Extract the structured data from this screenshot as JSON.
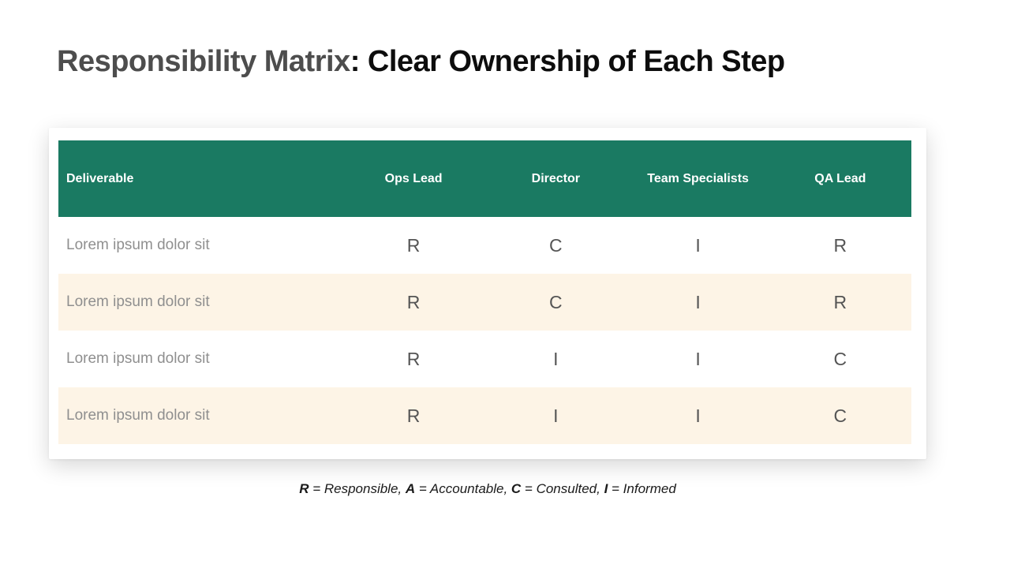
{
  "title": {
    "prefix": "Responsibility Matrix",
    "emphasis": ": Clear Ownership of Each Step"
  },
  "table": {
    "columns": [
      "Deliverable",
      "Ops Lead",
      "Director",
      "Team Specialists",
      "QA Lead"
    ],
    "rows": [
      {
        "deliverable": "Lorem ipsum dolor sit",
        "values": [
          "R",
          "C",
          "I",
          "R"
        ]
      },
      {
        "deliverable": "Lorem ipsum dolor sit",
        "values": [
          "R",
          "C",
          "I",
          "R"
        ]
      },
      {
        "deliverable": "Lorem ipsum dolor sit",
        "values": [
          "R",
          "I",
          "I",
          "C"
        ]
      },
      {
        "deliverable": "Lorem ipsum dolor sit",
        "values": [
          "R",
          "I",
          "I",
          "C"
        ]
      }
    ]
  },
  "legend": {
    "parts": [
      {
        "key": "R",
        "definition": " = Responsible, "
      },
      {
        "key": "A",
        "definition": " = Accountable, "
      },
      {
        "key": "C",
        "definition": " = Consulted, "
      },
      {
        "key": "I",
        "definition": " = Informed"
      }
    ]
  },
  "colors": {
    "header_bg": "#1a7a62",
    "header_text": "#ffffff",
    "row_bg": "#ffffff",
    "row_alt_bg": "#fdf4e6",
    "title_prefix": "#4d4d4d",
    "title_emphasis": "#0d0d0d",
    "cell_text": "#555555",
    "deliverable_text": "#8f8f8f"
  }
}
